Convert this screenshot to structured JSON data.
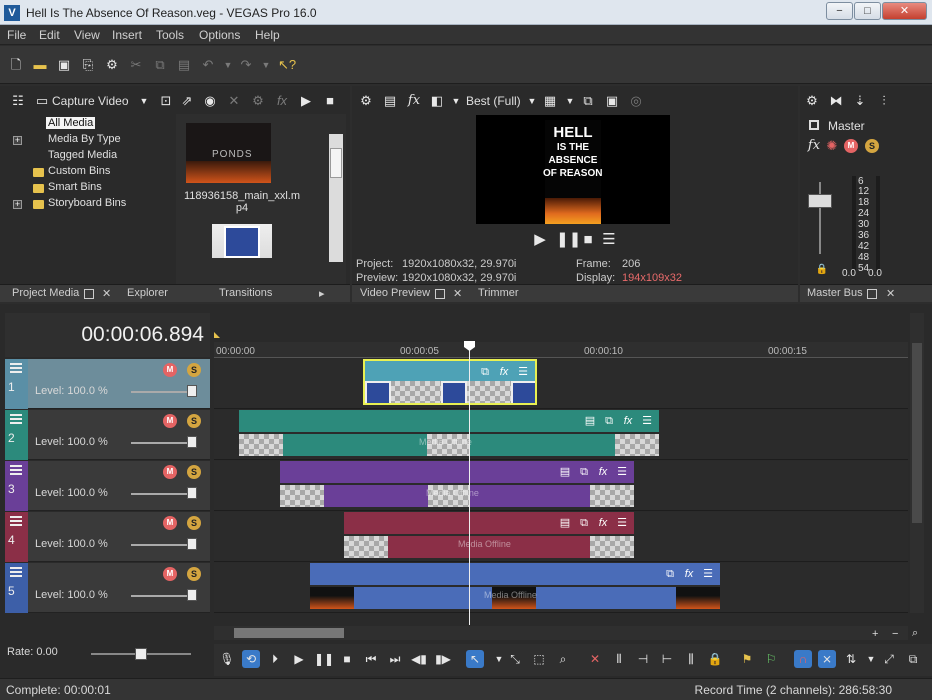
{
  "window": {
    "title": "Hell Is The Absence Of Reason.veg - VEGAS Pro 16.0",
    "app_icon": "V",
    "min": "−",
    "max": "□",
    "close": "✕"
  },
  "menu": [
    "File",
    "Edit",
    "View",
    "Insert",
    "Tools",
    "Options",
    "Help"
  ],
  "project_media": {
    "capture_label": "Capture Video",
    "tree": [
      "All Media",
      "Media By Type",
      "Tagged Media",
      "Custom Bins",
      "Smart Bins",
      "Storyboard Bins"
    ],
    "files": [
      {
        "name": "118936158_main_xxl.mp4",
        "thumb_text": "PONDS"
      }
    ]
  },
  "bottom_tabs": {
    "project_media": "Project Media",
    "explorer": "Explorer",
    "transitions": "Transitions",
    "video_preview": "Video Preview",
    "trimmer": "Trimmer",
    "master_bus": "Master Bus"
  },
  "preview": {
    "quality": "Best (Full)",
    "frame_text": [
      "HELL",
      "IS THE",
      "ABSENCE",
      "OF REASON"
    ],
    "project_label": "Project:",
    "project_value": "1920x1080x32, 29.970i",
    "preview_label": "Preview:",
    "preview_value": "1920x1080x32, 29.970i",
    "frame_label": "Frame:",
    "frame_value": "206",
    "display_label": "Display:",
    "display_value": "194x109x32"
  },
  "master": {
    "label": "Master",
    "meter_marks": [
      "6",
      "12",
      "18",
      "24",
      "30",
      "36",
      "42",
      "48",
      "54"
    ],
    "left_value": "0.0",
    "right_value": "0.0"
  },
  "timeline": {
    "timecode": "00:00:06.894",
    "ruler": [
      "00:00:00",
      "00:00:05",
      "00:00:10",
      "00:00:15"
    ],
    "tracks": [
      {
        "num": "1",
        "level": "Level: 100.0 %",
        "color": "#5a8fa6"
      },
      {
        "num": "2",
        "level": "Level: 100.0 %",
        "color": "#2c8a7c"
      },
      {
        "num": "3",
        "level": "Level: 100.0 %",
        "color": "#6a3f98"
      },
      {
        "num": "4",
        "level": "Level: 100.0 %",
        "color": "#8b2f47"
      },
      {
        "num": "5",
        "level": "Level: 100.0 %",
        "color": "#3d5fa8"
      }
    ],
    "offline_text": "Media Offline",
    "rate": "Rate: 0.00"
  },
  "status": {
    "left": "Complete: 00:00:01",
    "right": "Record Time (2 channels): 286:58:30"
  }
}
